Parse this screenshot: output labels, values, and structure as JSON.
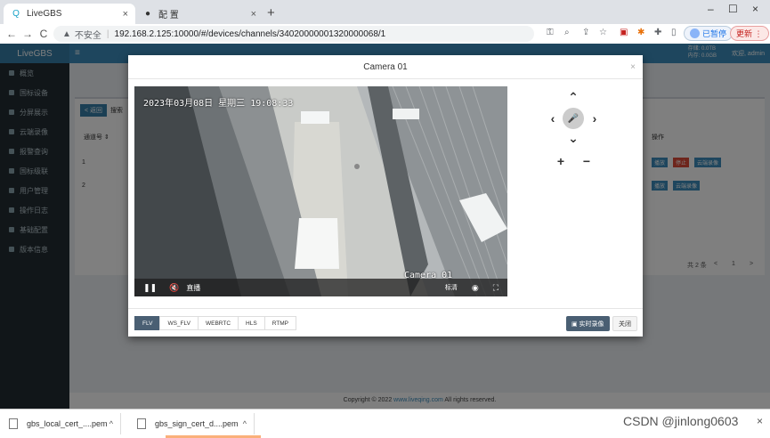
{
  "browser": {
    "tabs": [
      {
        "title": "LiveGBS",
        "close": "×"
      },
      {
        "title": "配 置",
        "close": "×"
      }
    ],
    "new_tab": "+",
    "window_controls": {
      "minimize": "–",
      "restore": "☐",
      "close": "×"
    },
    "nav": {
      "back": "←",
      "forward": "→",
      "reload": "C"
    },
    "omnibox": {
      "warning": "▲",
      "security_label": "不安全",
      "separator": "|",
      "url": "192.168.2.125:10000/#/devices/channels/34020000001320000068/1"
    },
    "toolbar_icons": [
      "key-icon",
      "zoom-icon",
      "share-icon",
      "star-icon",
      "extension-pdf-icon",
      "extension-icon",
      "puzzle-icon",
      "sidebar-icon"
    ],
    "sync_label": "已暂停",
    "update_label": "更新 ⋮"
  },
  "app": {
    "logo": "LiveGBS",
    "menu": [
      "概览",
      "国标设备",
      "分屏展示",
      "云端录像",
      "报警查询",
      "国标级联",
      "用户管理",
      "操作日志",
      "基础配置",
      "版本信息"
    ],
    "topbar": {
      "stats_line1": "存储: 0.0TB",
      "stats_line2": "内存: 0.0GB",
      "user": "欢迎, admin"
    },
    "back_label": "< 返回",
    "search_label": "搜索",
    "table_headers": [
      "通道号 ⇕",
      "操作"
    ],
    "rows": [
      "1",
      "2"
    ],
    "actions": [
      {
        "label": "播放",
        "color": "#3c8dbc"
      },
      {
        "label": "停止",
        "color": "#dd4b39"
      },
      {
        "label": "云端录像",
        "color": "#3c8dbc"
      }
    ],
    "pagination": {
      "total": "共 2 条",
      "prev": "<",
      "page": "1",
      "next": ">"
    },
    "footer": {
      "prefix": "Copyright © 2022 ",
      "link": "www.liveqing.com",
      "suffix": " All rights reserved."
    }
  },
  "modal": {
    "title": "Camera 01",
    "close": "×",
    "video": {
      "osd_time": "2023年03月08日  星期三  19:08:33",
      "osd_camera": "Camera 01",
      "pause": "❚❚",
      "mute": "🔇",
      "live_label": "直播",
      "quality_label": "标清",
      "snapshot": "◉",
      "fullscreen": "⛶"
    },
    "ptz": {
      "up": "⌃",
      "down": "⌄",
      "left": "‹",
      "right": "›",
      "center": "🎤",
      "zoom_in": "+",
      "zoom_out": "−"
    },
    "formats": [
      {
        "label": "FLV",
        "active": true
      },
      {
        "label": "WS_FLV",
        "active": false
      },
      {
        "label": "WEBRTC",
        "active": false
      },
      {
        "label": "HLS",
        "active": false
      },
      {
        "label": "RTMP",
        "active": false
      }
    ],
    "record_button": "▣ 实时录像",
    "close_button": "关闭"
  },
  "downloads": [
    {
      "name": "gbs_local_cert_....pem",
      "chevron": "^"
    },
    {
      "name": "gbs_sign_cert_d....pem",
      "chevron": "^"
    }
  ],
  "downloads_close": "×",
  "watermark": "CSDN @jinlong0603"
}
